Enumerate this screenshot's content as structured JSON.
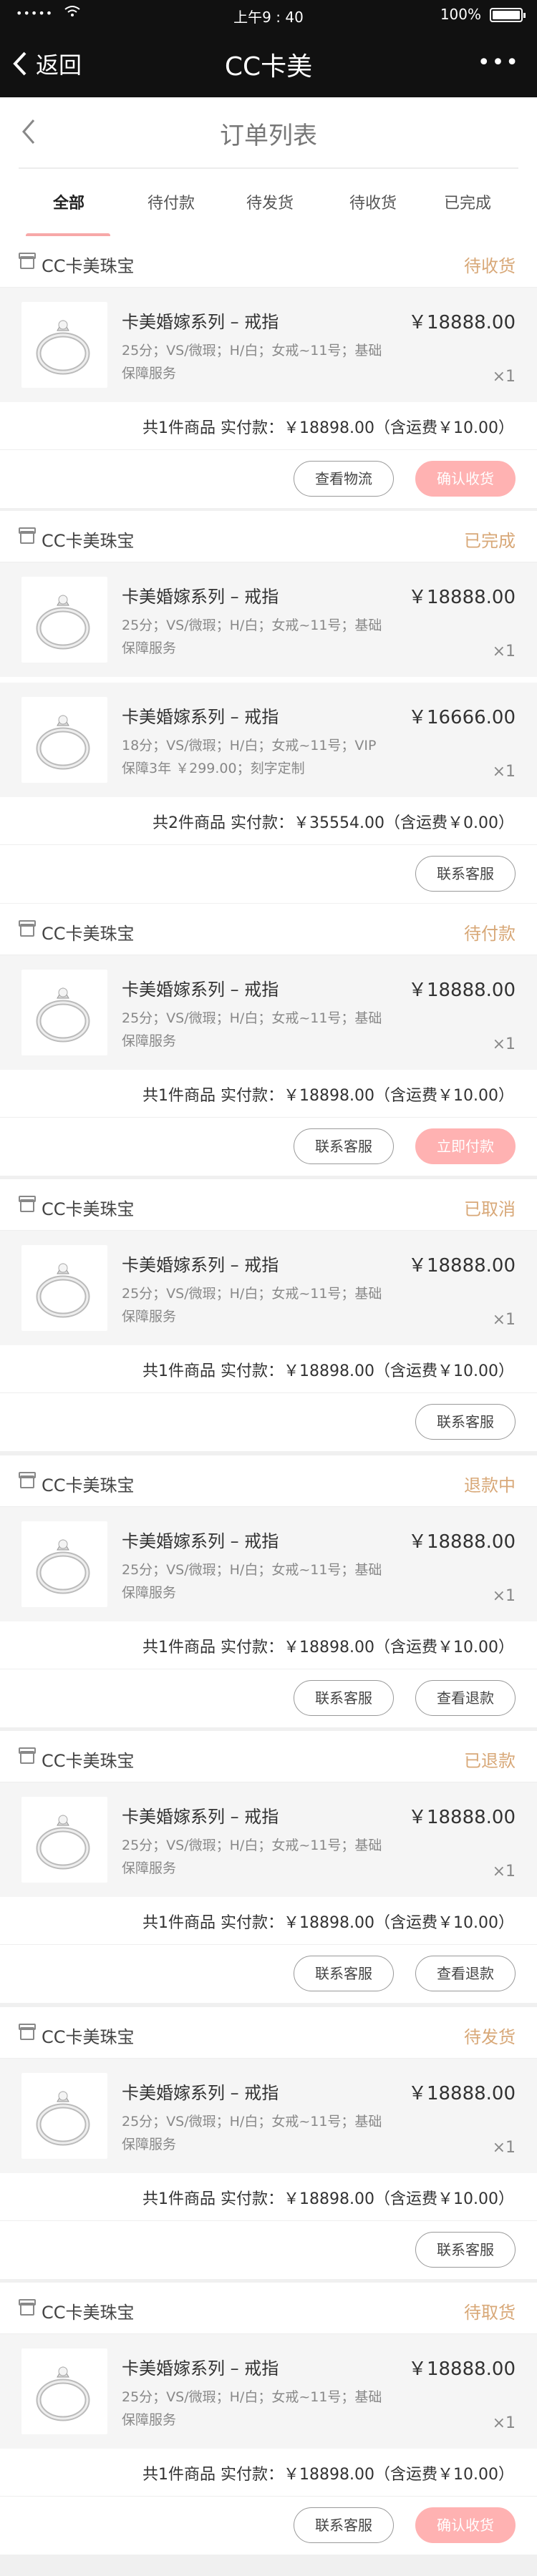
{
  "status_bar": {
    "time": "上午9 : 40",
    "battery": "100%",
    "signal": "•••••"
  },
  "navbar": {
    "back_label": "返回",
    "title": "CC卡美",
    "more": "•••"
  },
  "subheader": {
    "title": "订单列表"
  },
  "tabs": [
    {
      "label": "全部",
      "active": true
    },
    {
      "label": "待付款",
      "active": false
    },
    {
      "label": "待发货",
      "active": false
    },
    {
      "label": "待收货",
      "active": false
    },
    {
      "label": "已完成",
      "active": false
    }
  ],
  "orders": [
    {
      "shop": "CC卡美珠宝",
      "status": "待收货",
      "items": [
        {
          "name": "卡美婚嫁系列 – 戒指",
          "price": "￥18888.00",
          "desc": "25分；VS/微瑕；H/白；女戒~11号；基础保障服务",
          "qty": "×1"
        }
      ],
      "summary": "共1件商品 实付款：￥18898.00（含运费￥10.00）",
      "buttons": [
        {
          "label": "查看物流",
          "primary": false
        },
        {
          "label": "确认收货",
          "primary": true
        }
      ]
    },
    {
      "shop": "CC卡美珠宝",
      "status": "已完成",
      "items": [
        {
          "name": "卡美婚嫁系列 – 戒指",
          "price": "￥18888.00",
          "desc": "25分；VS/微瑕；H/白；女戒~11号；基础保障服务",
          "qty": "×1"
        },
        {
          "name": "卡美婚嫁系列 – 戒指",
          "price": "￥16666.00",
          "desc": "18分；VS/微瑕；H/白；女戒~11号；VIP保障3年 ￥299.00；刻字定制",
          "qty": "×1"
        }
      ],
      "summary": "共2件商品 实付款：￥35554.00（含运费￥0.00）",
      "buttons": [
        {
          "label": "联系客服",
          "primary": false
        }
      ]
    },
    {
      "shop": "CC卡美珠宝",
      "status": "待付款",
      "items": [
        {
          "name": "卡美婚嫁系列 – 戒指",
          "price": "￥18888.00",
          "desc": "25分；VS/微瑕；H/白；女戒~11号；基础保障服务",
          "qty": "×1"
        }
      ],
      "summary": "共1件商品 实付款：￥18898.00（含运费￥10.00）",
      "buttons": [
        {
          "label": "联系客服",
          "primary": false
        },
        {
          "label": "立即付款",
          "primary": true
        }
      ]
    },
    {
      "shop": "CC卡美珠宝",
      "status": "已取消",
      "items": [
        {
          "name": "卡美婚嫁系列 – 戒指",
          "price": "￥18888.00",
          "desc": "25分；VS/微瑕；H/白；女戒~11号；基础保障服务",
          "qty": "×1"
        }
      ],
      "summary": "共1件商品 实付款：￥18898.00（含运费￥10.00）",
      "buttons": [
        {
          "label": "联系客服",
          "primary": false
        }
      ]
    },
    {
      "shop": "CC卡美珠宝",
      "status": "退款中",
      "items": [
        {
          "name": "卡美婚嫁系列 – 戒指",
          "price": "￥18888.00",
          "desc": "25分；VS/微瑕；H/白；女戒~11号；基础保障服务",
          "qty": "×1"
        }
      ],
      "summary": "共1件商品 实付款：￥18898.00（含运费￥10.00）",
      "buttons": [
        {
          "label": "联系客服",
          "primary": false
        },
        {
          "label": "查看退款",
          "primary": false
        }
      ]
    },
    {
      "shop": "CC卡美珠宝",
      "status": "已退款",
      "items": [
        {
          "name": "卡美婚嫁系列 – 戒指",
          "price": "￥18888.00",
          "desc": "25分；VS/微瑕；H/白；女戒~11号；基础保障服务",
          "qty": "×1"
        }
      ],
      "summary": "共1件商品 实付款：￥18898.00（含运费￥10.00）",
      "buttons": [
        {
          "label": "联系客服",
          "primary": false
        },
        {
          "label": "查看退款",
          "primary": false
        }
      ]
    },
    {
      "shop": "CC卡美珠宝",
      "status": "待发货",
      "items": [
        {
          "name": "卡美婚嫁系列 – 戒指",
          "price": "￥18888.00",
          "desc": "25分；VS/微瑕；H/白；女戒~11号；基础保障服务",
          "qty": "×1"
        }
      ],
      "summary": "共1件商品 实付款：￥18898.00（含运费￥10.00）",
      "buttons": [
        {
          "label": "联系客服",
          "primary": false
        }
      ]
    },
    {
      "shop": "CC卡美珠宝",
      "status": "待取货",
      "items": [
        {
          "name": "卡美婚嫁系列 – 戒指",
          "price": "￥18888.00",
          "desc": "25分；VS/微瑕；H/白；女戒~11号；基础保障服务",
          "qty": "×1"
        }
      ],
      "summary": "共1件商品 实付款：￥18898.00（含运费￥10.00）",
      "buttons": [
        {
          "label": "联系客服",
          "primary": false
        },
        {
          "label": "确认收货",
          "primary": true
        }
      ]
    }
  ],
  "colors": {
    "accent": "#ffb2b2",
    "status": "#d8a878",
    "bar": "#111111"
  }
}
